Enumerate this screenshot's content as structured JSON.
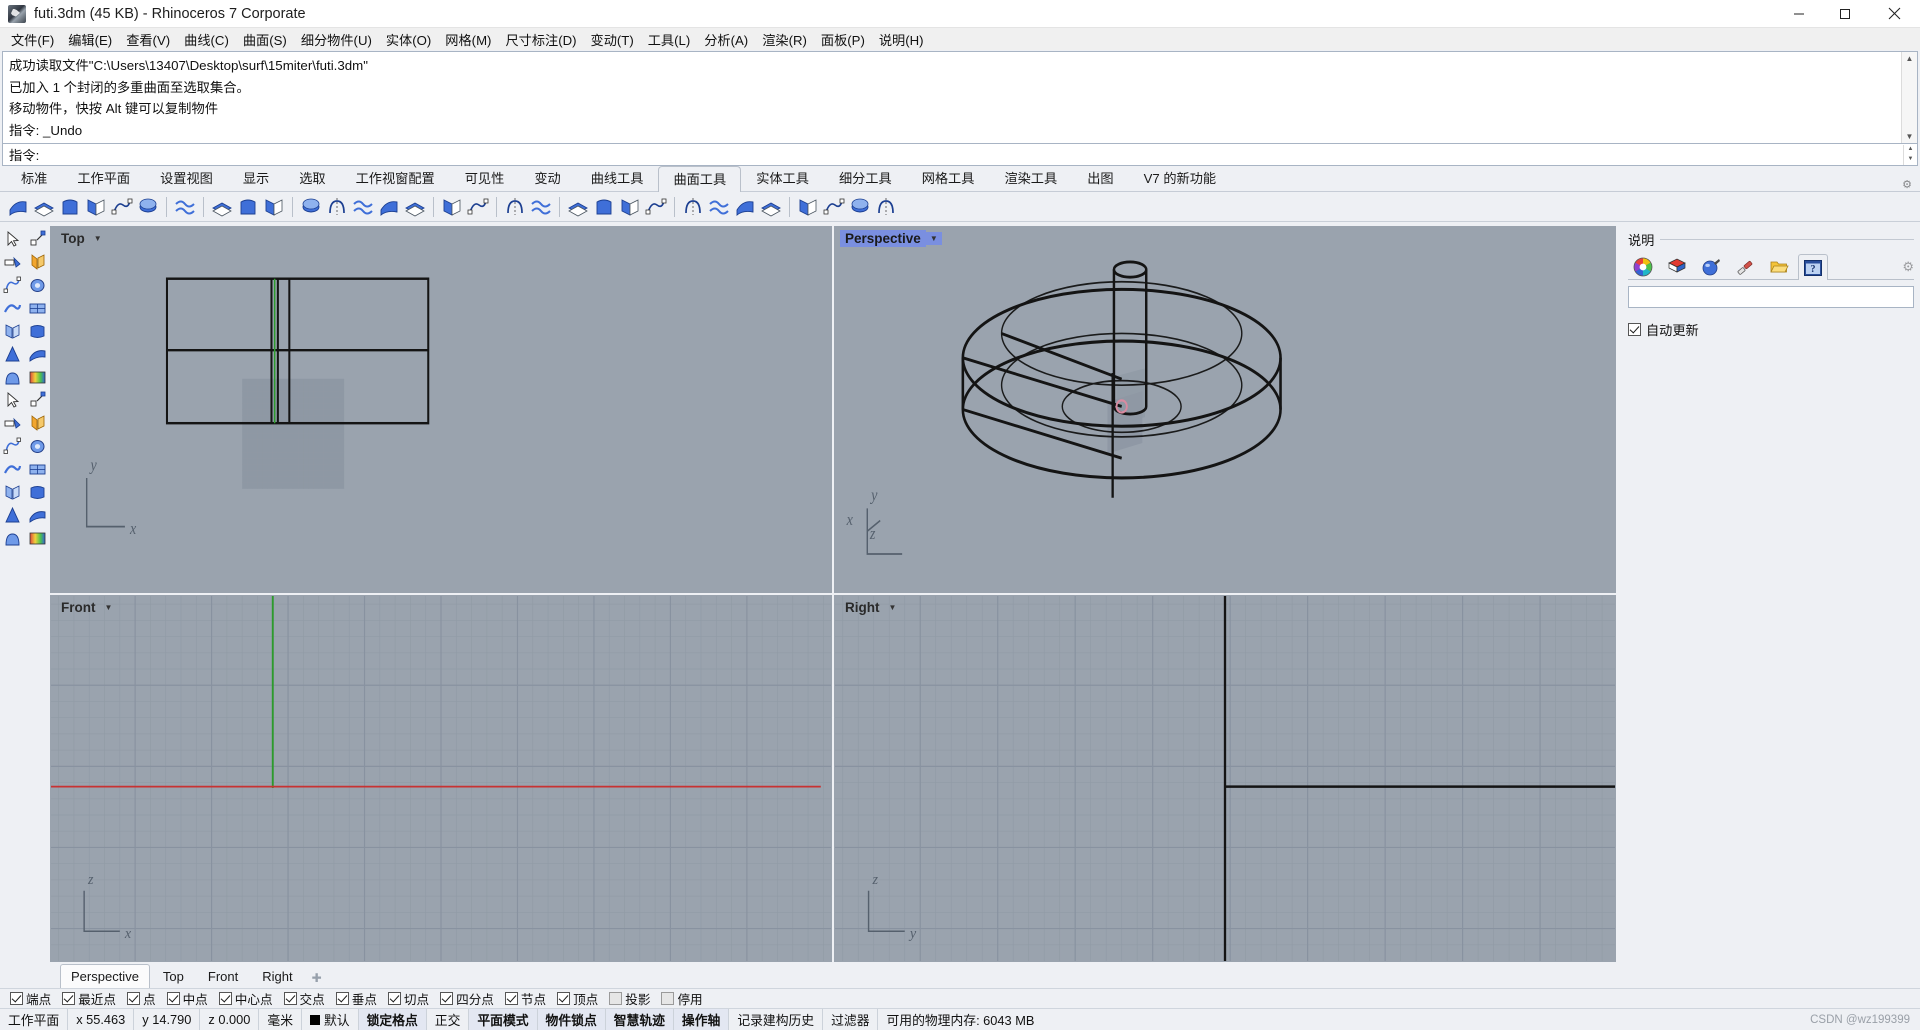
{
  "titlebar": {
    "icon": "rhino-app-icon",
    "title": "futi.3dm (45 KB) - Rhinoceros 7 Corporate",
    "minimize": "minimize-icon",
    "maximize": "maximize-icon",
    "close": "close-icon"
  },
  "menubar": {
    "items": [
      {
        "label": "文件(F)"
      },
      {
        "label": "编辑(E)"
      },
      {
        "label": "查看(V)"
      },
      {
        "label": "曲线(C)"
      },
      {
        "label": "曲面(S)"
      },
      {
        "label": "细分物件(U)"
      },
      {
        "label": "实体(O)"
      },
      {
        "label": "网格(M)"
      },
      {
        "label": "尺寸标注(D)"
      },
      {
        "label": "变动(T)"
      },
      {
        "label": "工具(L)"
      },
      {
        "label": "分析(A)"
      },
      {
        "label": "渲染(R)"
      },
      {
        "label": "面板(P)"
      },
      {
        "label": "说明(H)"
      }
    ]
  },
  "command": {
    "history": [
      "成功读取文件\"C:\\Users\\13407\\Desktop\\surf\\15miter\\futi.3dm\"",
      "已加入 1 个封闭的多重曲面至选取集合。",
      "移动物件，快按 Alt 键可以复制物件",
      "指令: _Undo"
    ],
    "prompt_label": "指令:",
    "prompt_value": ""
  },
  "ribbon": {
    "tabs": [
      {
        "label": "标准",
        "active": false
      },
      {
        "label": "工作平面",
        "active": false
      },
      {
        "label": "设置视图",
        "active": false
      },
      {
        "label": "显示",
        "active": false
      },
      {
        "label": "选取",
        "active": false
      },
      {
        "label": "工作视窗配置",
        "active": false
      },
      {
        "label": "可见性",
        "active": false
      },
      {
        "label": "变动",
        "active": false
      },
      {
        "label": "曲线工具",
        "active": false
      },
      {
        "label": "曲面工具",
        "active": true
      },
      {
        "label": "实体工具",
        "active": false
      },
      {
        "label": "细分工具",
        "active": false
      },
      {
        "label": "网格工具",
        "active": false
      },
      {
        "label": "渲染工具",
        "active": false
      },
      {
        "label": "出图",
        "active": false
      },
      {
        "label": "V7 的新功能",
        "active": false
      }
    ],
    "settings_icon": "gear-icon"
  },
  "toolbar_icons": [
    "surface-from-edge-curves-icon",
    "surface-from-planar-curves-icon",
    "surface-from-network-icon",
    "surface-corner-points-icon",
    "surface-3-point-icon",
    "surface-extrude-icon",
    "SEP",
    "surface-fit-icon",
    "SEP",
    "revolve-icon",
    "rail-revolve-icon",
    "sweep-1-rail-icon",
    "SEP",
    "loft-icon",
    "extrude-curve-icon",
    "extrude-curve-tapered-icon",
    "patch-icon",
    "drape-icon",
    "SEP",
    "fit-icon",
    "deg-icon",
    "SEP",
    "offset-surface-icon",
    "blend-surface-icon",
    "SEP",
    "surface-fillet-icon",
    "surface-chamfer-icon",
    "match-surface-icon",
    "merge-surface-icon",
    "SEP",
    "untrim-icon",
    "split-surface-icon",
    "shrink-surface-icon",
    "extend-surface-icon",
    "SEP",
    "rebuild-surface-icon",
    "unroll-surface-icon",
    "surface-analysis-icon",
    "heightfield-icon"
  ],
  "left_toolbar_icons": [
    "select-arrow-icon",
    "select-window-icon",
    "trim-icon",
    "split-icon",
    "explode-icon",
    "join-icon",
    "control-points-on-icon",
    "surface-points-icon",
    "ellipse-icon",
    "fillet-icon",
    "surface-blend-icon",
    "surface-patch-icon",
    "plane-surface-icon",
    "plane-3point-icon",
    "surface-edge-icon",
    "surface-network-icon",
    "extrude-surface-icon",
    "heightfield-grid-icon",
    "cylinder-icon",
    "tube-icon",
    "cone-surface-icon",
    "cone-icon",
    "sweep-curve-icon",
    "sphere-cut-icon",
    "sweep1-icon",
    "sweep2-icon",
    "revolve-solid-icon",
    "drape-mesh-icon"
  ],
  "viewports": [
    {
      "name": "Top",
      "active": false,
      "axes": [
        "y",
        "x"
      ],
      "position": "top-left"
    },
    {
      "name": "Perspective",
      "active": true,
      "axes": [
        "y",
        "z",
        "x"
      ],
      "position": "top-right"
    },
    {
      "name": "Front",
      "active": false,
      "axes": [
        "z",
        "x"
      ],
      "position": "bottom-left"
    },
    {
      "name": "Right",
      "active": false,
      "axes": [
        "z",
        "y"
      ],
      "position": "bottom-right"
    }
  ],
  "viewport_tabs": {
    "items": [
      {
        "label": "Perspective",
        "active": true
      },
      {
        "label": "Top",
        "active": false
      },
      {
        "label": "Front",
        "active": false
      },
      {
        "label": "Right",
        "active": false
      }
    ],
    "add": "add-viewport-icon"
  },
  "right_panel": {
    "title": "说明",
    "tabs": [
      {
        "icon": "color-wheel-icon",
        "active": false
      },
      {
        "icon": "layers-icon",
        "active": false
      },
      {
        "icon": "material-sphere-icon",
        "active": false
      },
      {
        "icon": "paintbrush-icon",
        "active": false
      },
      {
        "icon": "open-folder-icon",
        "active": false
      },
      {
        "icon": "help-icon",
        "active": true
      }
    ],
    "settings_icon": "gear-icon",
    "search_value": "",
    "autoupdate_label": "自动更新",
    "autoupdate_checked": true
  },
  "osnap_bar": {
    "items": [
      {
        "label": "端点",
        "checked": true
      },
      {
        "label": "最近点",
        "checked": true
      },
      {
        "label": "点",
        "checked": true
      },
      {
        "label": "中点",
        "checked": true
      },
      {
        "label": "中心点",
        "checked": true
      },
      {
        "label": "交点",
        "checked": true
      },
      {
        "label": "垂点",
        "checked": true
      },
      {
        "label": "切点",
        "checked": true
      },
      {
        "label": "四分点",
        "checked": true
      },
      {
        "label": "节点",
        "checked": true
      },
      {
        "label": "顶点",
        "checked": true
      },
      {
        "label": "投影",
        "checked": false
      },
      {
        "label": "停用",
        "checked": false
      }
    ]
  },
  "status_bar": {
    "cplane_label": "工作平面",
    "x": "x 55.463",
    "y": "y 14.790",
    "z": "z 0.000",
    "units": "毫米",
    "layer": "默认",
    "layer_color": "#000000",
    "toggles": [
      {
        "label": "锁定格点",
        "on": true
      },
      {
        "label": "正交",
        "on": false
      },
      {
        "label": "平面模式",
        "on": true
      },
      {
        "label": "物件锁点",
        "on": true
      },
      {
        "label": "智慧轨迹",
        "on": true
      },
      {
        "label": "操作轴",
        "on": true
      },
      {
        "label": "记录建构历史",
        "on": false
      },
      {
        "label": "过滤器",
        "on": false
      }
    ],
    "memory": "可用的物理内存: 6043 MB",
    "watermark": "CSDN @wz199399"
  },
  "colors": {
    "viewport_bg": "#9aa3ae",
    "viewport_grid": "#8d96a2",
    "chrome": "#eef0f4",
    "accent_blue": "#7a8fe0",
    "axis_red": "#c83232",
    "axis_green": "#2d9a2d",
    "wire_black": "#141414"
  }
}
